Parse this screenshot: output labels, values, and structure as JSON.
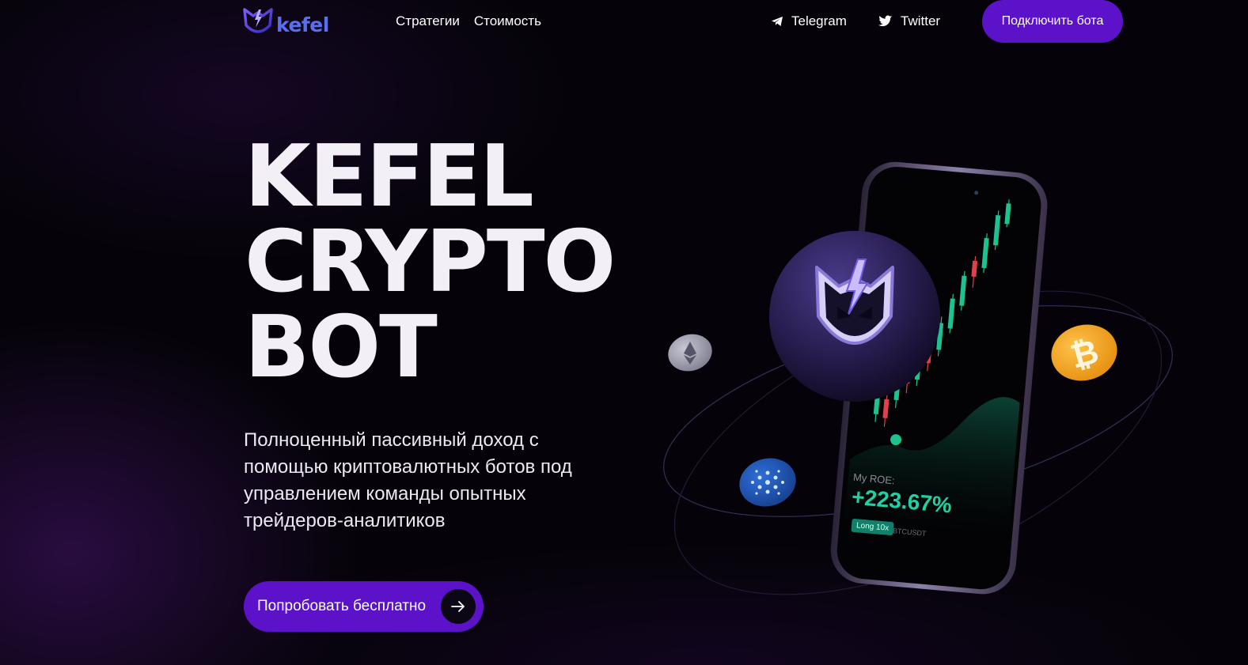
{
  "header": {
    "logo_text": "kefel",
    "nav": [
      {
        "label": "Стратегии"
      },
      {
        "label": "Стоимость"
      }
    ],
    "telegram_label": "Telegram",
    "twitter_label": "Twitter",
    "connect_button": "Подключить бота"
  },
  "hero": {
    "title_lines": [
      "KEFEL",
      "CRYPTO",
      "BOT"
    ],
    "subtitle": "Полноценный пассивный доход с помощью криптовалютных ботов под управлением команды опытных трейдеров-аналитиков",
    "cta_label": "Попробовать бесплатно"
  },
  "phone": {
    "roe_label": "My ROE:",
    "roe_value": "+223.67%",
    "position_badge": "Long 10x",
    "pair": "BTCUSDT"
  },
  "colors": {
    "accent": "#5b12c9",
    "background": "#050309",
    "profit": "#1fd1a2",
    "bitcoin": "#f7a823",
    "cardano": "#1f56b8"
  },
  "icons": [
    "kefel-logo-icon",
    "telegram-icon",
    "twitter-icon",
    "arrow-right-icon",
    "ethereum-coin-icon",
    "bitcoin-coin-icon",
    "cardano-coin-icon"
  ]
}
